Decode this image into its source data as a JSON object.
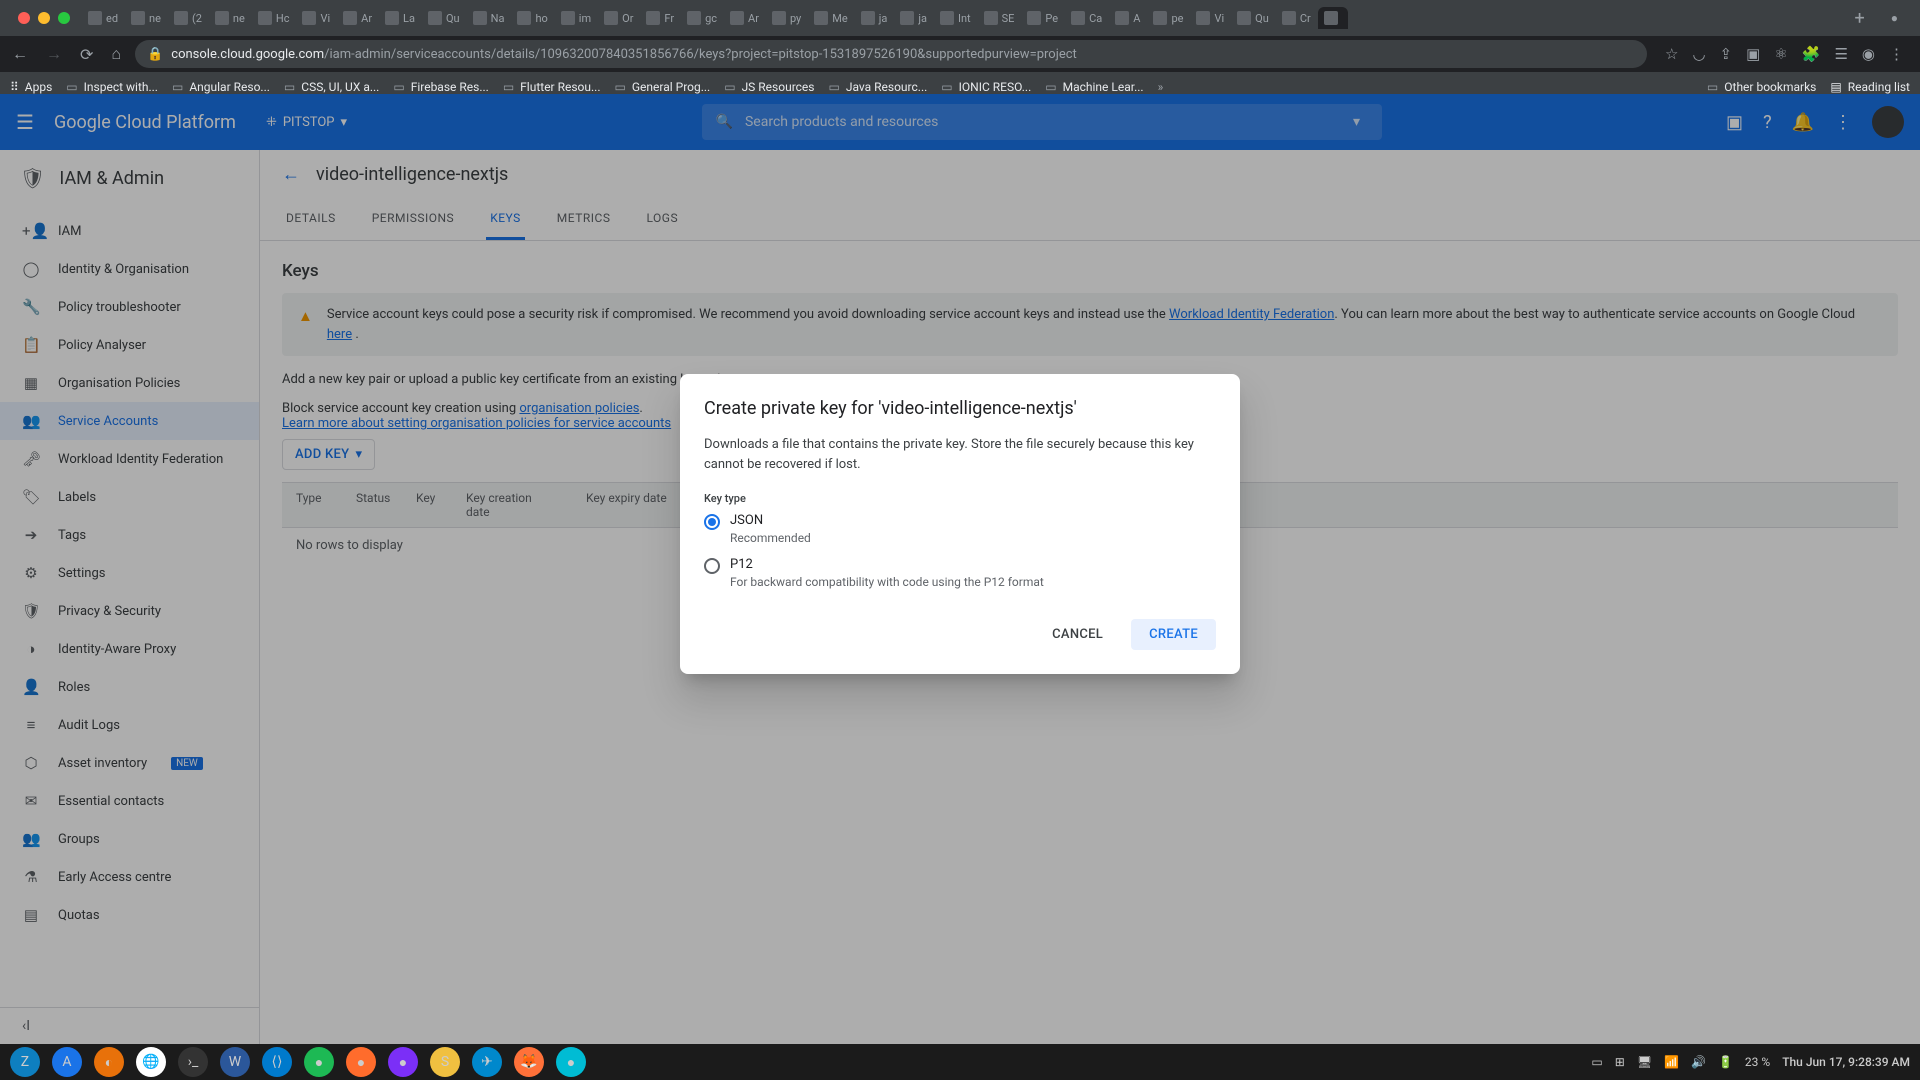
{
  "browser": {
    "url_host": "console.cloud.google.com",
    "url_path": "/iam-admin/serviceaccounts/details/109632007840351856766/keys?project=pitstop-1531897526190&supportedpurview=project",
    "tabs": [
      "ed",
      "ne",
      "(2",
      "ne",
      "Hc",
      "Vi",
      "Ar",
      "La",
      "Qu",
      "Na",
      "ho",
      "im",
      "Or",
      "Fr",
      "gc",
      "Ar",
      "py",
      "Me",
      "ja",
      "ja",
      "Int",
      "SE",
      "Pe",
      "Ca",
      "A",
      "pe",
      "Vi",
      "Qu",
      "Cr",
      ""
    ],
    "active_tab_index": 29,
    "bookmarks": [
      "Apps",
      "Inspect with...",
      "Angular Reso...",
      "CSS, UI, UX a...",
      "Firebase Res...",
      "Flutter Resou...",
      "General Prog...",
      "JS Resources",
      "Java Resourc...",
      "IONIC RESO...",
      "Machine Lear..."
    ],
    "other_bookmarks": "Other bookmarks",
    "reading_list": "Reading list"
  },
  "gcp": {
    "brand": "Google Cloud Platform",
    "project": "PITSTOP",
    "search_placeholder": "Search products and resources"
  },
  "sidebar": {
    "title": "IAM & Admin",
    "items": [
      {
        "icon": "+👤",
        "label": "IAM"
      },
      {
        "icon": "◯",
        "label": "Identity & Organisation"
      },
      {
        "icon": "🔧",
        "label": "Policy troubleshooter"
      },
      {
        "icon": "📋",
        "label": "Policy Analyser"
      },
      {
        "icon": "▦",
        "label": "Organisation Policies"
      },
      {
        "icon": "👥",
        "label": "Service Accounts"
      },
      {
        "icon": "🗝",
        "label": "Workload Identity Federation"
      },
      {
        "icon": "🏷",
        "label": "Labels"
      },
      {
        "icon": "➔",
        "label": "Tags"
      },
      {
        "icon": "⚙",
        "label": "Settings"
      },
      {
        "icon": "🛡",
        "label": "Privacy & Security"
      },
      {
        "icon": "◑",
        "label": "Identity-Aware Proxy"
      },
      {
        "icon": "👤",
        "label": "Roles"
      },
      {
        "icon": "≡",
        "label": "Audit Logs"
      },
      {
        "icon": "⬡",
        "label": "Asset inventory",
        "badge": "NEW"
      },
      {
        "icon": "✉",
        "label": "Essential contacts"
      },
      {
        "icon": "👥",
        "label": "Groups"
      },
      {
        "icon": "⚗",
        "label": "Early Access centre"
      },
      {
        "icon": "▤",
        "label": "Quotas"
      }
    ],
    "active_index": 5
  },
  "main": {
    "page_title": "video-intelligence-nextjs",
    "tabs": [
      "DETAILS",
      "PERMISSIONS",
      "KEYS",
      "METRICS",
      "LOGS"
    ],
    "active_tab_index": 2,
    "section_title": "Keys",
    "warning_pre": "Service account keys could pose a security risk if compromised. We recommend you avoid downloading service account keys and instead use the ",
    "warning_link1": "Workload Identity Federation",
    "warning_mid1": ". You can learn more about the best way to authenticate service accounts on Google Cloud ",
    "warning_link2": "here",
    "warning_post": " .",
    "desc": "Add a new key pair or upload a public key certificate from an existing key pair.",
    "block_pre": "Block service account key creation using ",
    "block_link": "organisation policies",
    "block_post": ".",
    "learn_more": "Learn more about setting organisation policies for service accounts",
    "add_key": "ADD KEY",
    "table_headers": [
      "Type",
      "Status",
      "Key",
      "Key creation date",
      "Key expiry date"
    ],
    "empty": "No rows to display"
  },
  "dialog": {
    "title": "Create private key for 'video-intelligence-nextjs'",
    "body": "Downloads a file that contains the private key. Store the file securely because this key cannot be recovered if lost.",
    "section": "Key type",
    "opt1_label": "JSON",
    "opt1_hint": "Recommended",
    "opt2_label": "P12",
    "opt2_hint": "For backward compatibility with code using the P12 format",
    "cancel": "CANCEL",
    "create": "CREATE"
  },
  "taskbar": {
    "battery": "23 %",
    "datetime": "Thu Jun 17,  9:28:39 AM"
  }
}
